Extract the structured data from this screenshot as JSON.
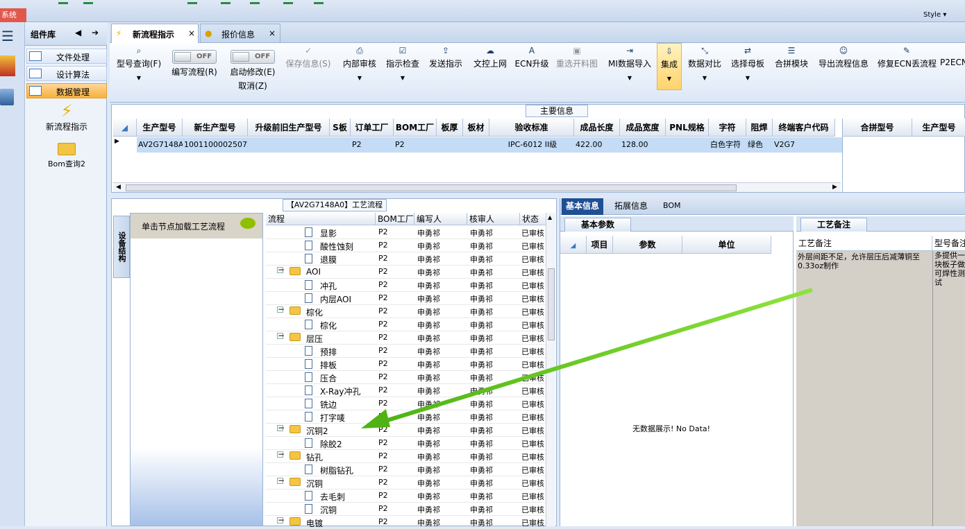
{
  "app": {
    "system_label": "系统",
    "style_label": "Style"
  },
  "component_library": {
    "title": "组件库",
    "items": [
      {
        "label": "文件处理"
      },
      {
        "label": "设计算法"
      },
      {
        "label": "数据管理"
      }
    ],
    "tiles": [
      {
        "label": "新流程指示"
      },
      {
        "label": "Bom查询2"
      }
    ]
  },
  "tabs": [
    {
      "label": "新流程指示"
    },
    {
      "label": "报价信息"
    }
  ],
  "ribbon": {
    "buttons": [
      {
        "label": "型号查询(F)"
      },
      {
        "label": "编写流程(R)",
        "toggle": "OFF"
      },
      {
        "label": "启动修改(E)",
        "sublabel": "取消(Z)",
        "toggle": "OFF"
      },
      {
        "label": "保存信息(S)"
      },
      {
        "label": "内部审核"
      },
      {
        "label": "指示检查"
      },
      {
        "label": "发送指示"
      },
      {
        "label": "文控上网"
      },
      {
        "label": "ECN升级"
      },
      {
        "label": "重选开料图"
      },
      {
        "label": "MI数据导入"
      },
      {
        "label": "集成"
      },
      {
        "label": "数据对比"
      },
      {
        "label": "选择母板"
      },
      {
        "label": "合拼模块"
      },
      {
        "label": "导出流程信息"
      },
      {
        "label": "修复ECN丢流程"
      },
      {
        "label": "P2ECN"
      }
    ]
  },
  "main_info": {
    "title": "主要信息",
    "columns": [
      "生产型号",
      "新生产型号",
      "升级前旧生产型号",
      "S板",
      "订单工厂",
      "BOM工厂",
      "板厚",
      "板材",
      "验收标准",
      "成品长度",
      "成品宽度",
      "PNL规格",
      "字符",
      "阻焊",
      "终端客户代码"
    ],
    "row": [
      "AV2G7148A0",
      "10011000025072",
      "",
      "",
      "P2",
      "P2",
      "",
      "",
      "IPC-6012 II级",
      "422.00",
      "128.00",
      "",
      "白色字符",
      "绿色",
      "V2G7"
    ],
    "right_columns": [
      "合拼型号",
      "生产型号"
    ]
  },
  "process": {
    "title": "【AV2G7148A0】工艺流程",
    "side_tab": "设备结构",
    "node_hint": "单击节点加载工艺流程",
    "columns": [
      "流程",
      "BOM工厂",
      "编写人",
      "核审人",
      "状态"
    ],
    "rows": [
      {
        "name": "显影",
        "level": 2,
        "factory": "P2",
        "writer": "申勇祁",
        "reviewer": "申勇祁",
        "status": "已审核"
      },
      {
        "name": "酸性蚀刻",
        "level": 2,
        "factory": "P2",
        "writer": "申勇祁",
        "reviewer": "申勇祁",
        "status": "已审核"
      },
      {
        "name": "退膜",
        "level": 2,
        "factory": "P2",
        "writer": "申勇祁",
        "reviewer": "申勇祁",
        "status": "已审核"
      },
      {
        "name": "AOI",
        "level": 1,
        "factory": "P2",
        "writer": "申勇祁",
        "reviewer": "申勇祁",
        "status": "已审核"
      },
      {
        "name": "冲孔",
        "level": 2,
        "factory": "P2",
        "writer": "申勇祁",
        "reviewer": "申勇祁",
        "status": "已审核"
      },
      {
        "name": "内层AOI",
        "level": 2,
        "factory": "P2",
        "writer": "申勇祁",
        "reviewer": "申勇祁",
        "status": "已审核"
      },
      {
        "name": "棕化",
        "level": 1,
        "factory": "P2",
        "writer": "申勇祁",
        "reviewer": "申勇祁",
        "status": "已审核"
      },
      {
        "name": "棕化",
        "level": 2,
        "factory": "P2",
        "writer": "申勇祁",
        "reviewer": "申勇祁",
        "status": "已审核"
      },
      {
        "name": "层压",
        "level": 1,
        "factory": "P2",
        "writer": "申勇祁",
        "reviewer": "申勇祁",
        "status": "已审核"
      },
      {
        "name": "预排",
        "level": 2,
        "factory": "P2",
        "writer": "申勇祁",
        "reviewer": "申勇祁",
        "status": "已审核"
      },
      {
        "name": "排板",
        "level": 2,
        "factory": "P2",
        "writer": "申勇祁",
        "reviewer": "申勇祁",
        "status": "已审核"
      },
      {
        "name": "压合",
        "level": 2,
        "factory": "P2",
        "writer": "申勇祁",
        "reviewer": "申勇祁",
        "status": "已审核"
      },
      {
        "name": "X-Ray冲孔",
        "level": 2,
        "factory": "P2",
        "writer": "申勇祁",
        "reviewer": "申勇祁",
        "status": "已审核"
      },
      {
        "name": "铣边",
        "level": 2,
        "factory": "P2",
        "writer": "申勇祁",
        "reviewer": "申勇祁",
        "status": "已审核"
      },
      {
        "name": "打字唛",
        "level": 2,
        "factory": "P2",
        "writer": "申勇祁",
        "reviewer": "申勇祁",
        "status": "已审核"
      },
      {
        "name": "沉铜2",
        "level": 1,
        "factory": "P2",
        "writer": "申勇祁",
        "reviewer": "申勇祁",
        "status": "已审核"
      },
      {
        "name": "除胶2",
        "level": 2,
        "factory": "P2",
        "writer": "申勇祁",
        "reviewer": "申勇祁",
        "status": "已审核"
      },
      {
        "name": "钻孔",
        "level": 1,
        "factory": "P2",
        "writer": "申勇祁",
        "reviewer": "申勇祁",
        "status": "已审核"
      },
      {
        "name": "树脂钻孔",
        "level": 2,
        "factory": "P2",
        "writer": "申勇祁",
        "reviewer": "申勇祁",
        "status": "已审核"
      },
      {
        "name": "沉铜",
        "level": 1,
        "factory": "P2",
        "writer": "申勇祁",
        "reviewer": "申勇祁",
        "status": "已审核"
      },
      {
        "name": "去毛刺",
        "level": 2,
        "factory": "P2",
        "writer": "申勇祁",
        "reviewer": "申勇祁",
        "status": "已审核"
      },
      {
        "name": "沉铜",
        "level": 2,
        "factory": "P2",
        "writer": "申勇祁",
        "reviewer": "申勇祁",
        "status": "已审核"
      },
      {
        "name": "电镀",
        "level": 1,
        "factory": "P2",
        "writer": "申勇祁",
        "reviewer": "申勇祁",
        "status": "已审核"
      }
    ]
  },
  "detail": {
    "tabs": [
      "基本信息",
      "拓展信息",
      "BOM"
    ],
    "basic_params_title": "基本参数",
    "basic_columns": [
      "项目",
      "参数",
      "单位"
    ],
    "no_data": "无数据展示! No Data!",
    "memo_title": "工艺备注",
    "memo_columns": [
      "工艺备注",
      "型号备注"
    ],
    "memo_text": "外层间距不足，允许层压后减薄铜至0.33oz制作",
    "model_memo_text": "多提供一块板子做可焊性测试"
  },
  "colors": {
    "accent": "#1f4f94",
    "arrow": "#66d41e",
    "selection": "#c4dcf6",
    "active_item": "#f7b13c"
  }
}
